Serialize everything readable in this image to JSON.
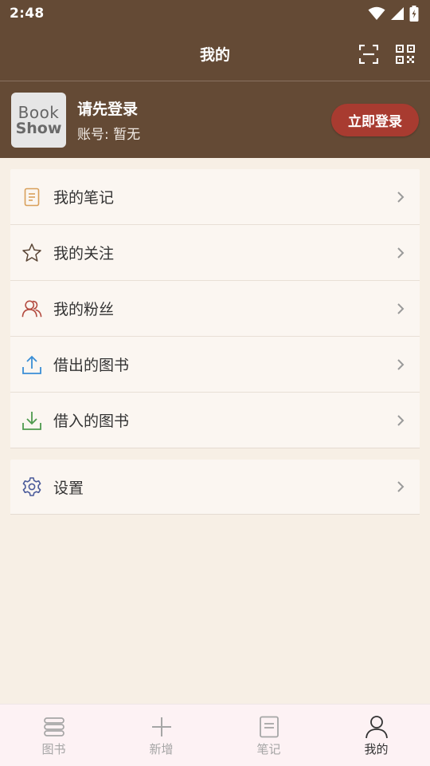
{
  "status": {
    "time": "2:48"
  },
  "header": {
    "title": "我的"
  },
  "profile": {
    "avatar_line1": "Book",
    "avatar_line2": "Show",
    "name": "请先登录",
    "account": "账号: 暂无",
    "login_label": "立即登录"
  },
  "menu": {
    "items": [
      {
        "label": "我的笔记",
        "icon": "note-icon",
        "color": "#d9a05b"
      },
      {
        "label": "我的关注",
        "icon": "star-icon",
        "color": "#5a4535"
      },
      {
        "label": "我的粉丝",
        "icon": "users-icon",
        "color": "#b34a3f"
      },
      {
        "label": "借出的图书",
        "icon": "upload-icon",
        "color": "#3a8ed6"
      },
      {
        "label": "借入的图书",
        "icon": "download-icon",
        "color": "#4e9a4e"
      }
    ],
    "settings": {
      "label": "设置",
      "icon": "settings-icon",
      "color": "#4a5a9a"
    }
  },
  "nav": {
    "items": [
      {
        "label": "图书",
        "icon": "books-icon"
      },
      {
        "label": "新增",
        "icon": "plus-icon"
      },
      {
        "label": "笔记",
        "icon": "note-icon"
      },
      {
        "label": "我的",
        "icon": "person-icon",
        "active": true
      }
    ]
  },
  "colors": {
    "header_bg": "#644a35",
    "login_button": "#a83b30",
    "page_bg": "#f7efe5"
  }
}
